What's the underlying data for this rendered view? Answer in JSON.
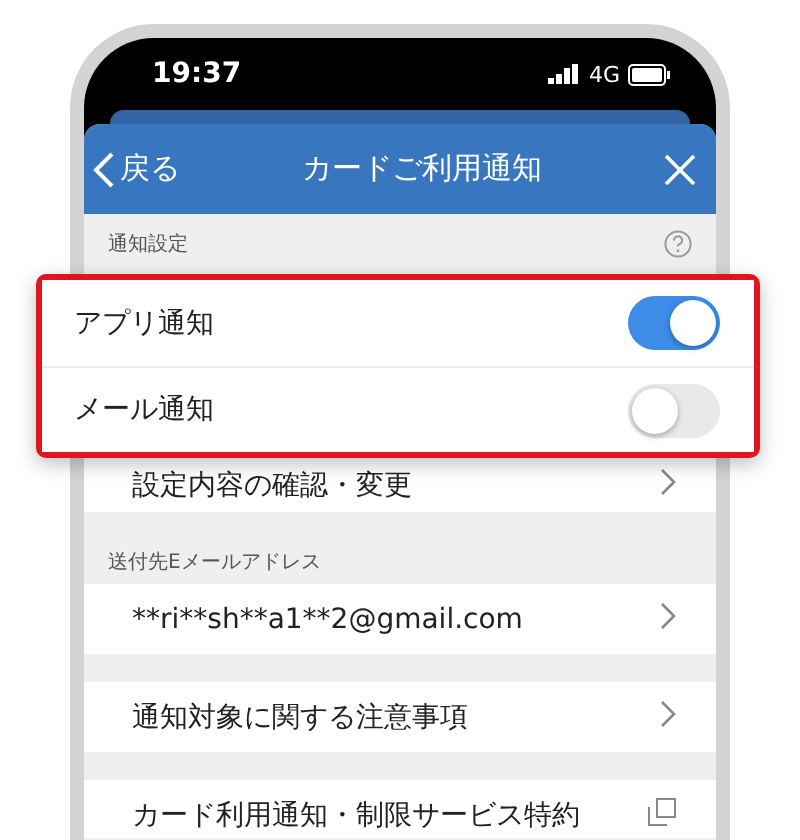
{
  "status_bar": {
    "time": "19:37",
    "network": "4G"
  },
  "header": {
    "back_label": "戻る",
    "title": "カードご利用通知"
  },
  "notification_settings": {
    "label": "通知設定",
    "toggles": [
      {
        "label": "アプリ通知",
        "on": true
      },
      {
        "label": "メール通知",
        "on": false
      }
    ],
    "link": "設定内容の確認・変更"
  },
  "email_section": {
    "label": "送付先Eメールアドレス",
    "address": "**ri**sh**a1**2@gmail.com"
  },
  "links": [
    {
      "label": "通知対象に関する注意事項",
      "kind": "chevron"
    },
    {
      "label": "カード利用通知・制限サービス特約",
      "kind": "external"
    }
  ]
}
